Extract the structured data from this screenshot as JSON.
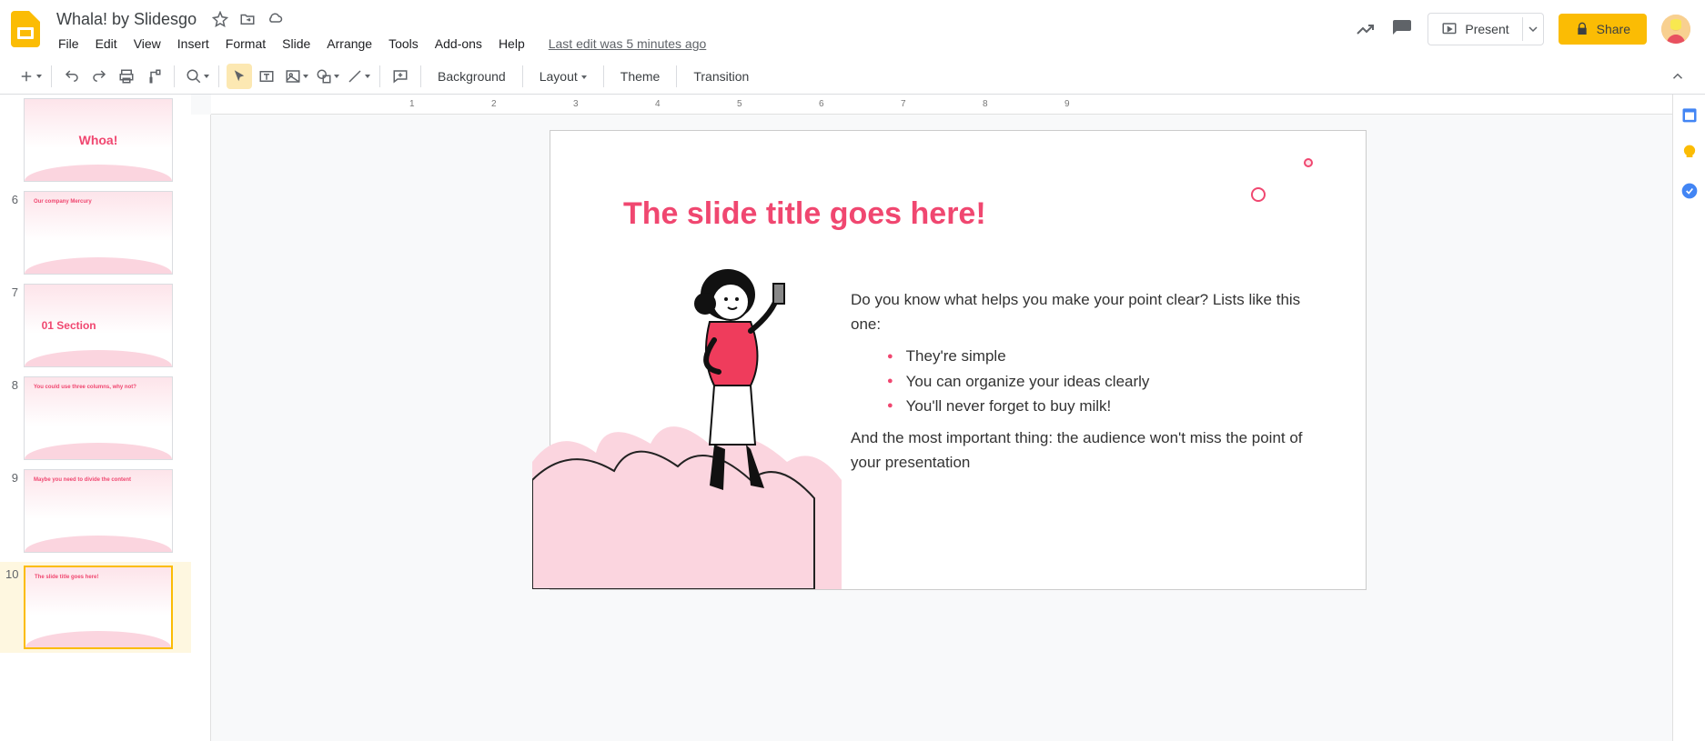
{
  "document": {
    "title": "Whala! by Slidesgo"
  },
  "menu": {
    "file": "File",
    "edit": "Edit",
    "view": "View",
    "insert": "Insert",
    "format": "Format",
    "slide": "Slide",
    "arrange": "Arrange",
    "tools": "Tools",
    "addons": "Add-ons",
    "help": "Help",
    "last_edit": "Last edit was 5 minutes ago"
  },
  "actions": {
    "present": "Present",
    "share": "Share"
  },
  "toolbar": {
    "background": "Background",
    "layout": "Layout",
    "theme": "Theme",
    "transition": "Transition"
  },
  "ruler_marks": [
    "1",
    "2",
    "3",
    "4",
    "5",
    "6",
    "7",
    "8",
    "9"
  ],
  "filmstrip": [
    {
      "num": "",
      "title": "Whoa!",
      "style": "pink-center"
    },
    {
      "num": "6",
      "title": "Our company Mercury",
      "style": "content"
    },
    {
      "num": "7",
      "title": "01 Section",
      "style": "section"
    },
    {
      "num": "8",
      "title": "You could use three columns, why not?",
      "style": "columns"
    },
    {
      "num": "9",
      "title": "Maybe you need to divide the content",
      "style": "divide"
    },
    {
      "num": "10",
      "title": "The slide title goes here!",
      "style": "current",
      "selected": true
    }
  ],
  "slide": {
    "title": "The slide title goes here!",
    "intro": "Do you know what helps you make your point clear? Lists like this one:",
    "bullets": [
      "They're simple",
      "You can organize your ideas clearly",
      "You'll never forget to buy milk!"
    ],
    "outro": "And the most important thing: the audience won't miss the point of your presentation"
  }
}
